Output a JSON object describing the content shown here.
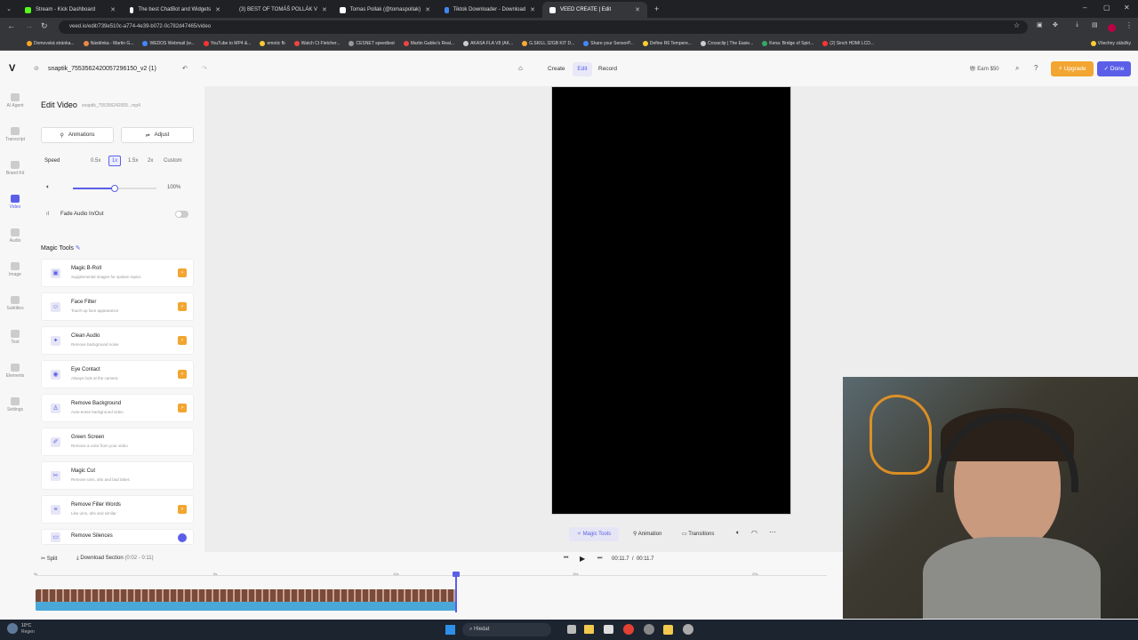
{
  "browser": {
    "tabs": [
      {
        "title": "Stream - Kick Dashboard",
        "color": "#53fc18"
      },
      {
        "title": "The best ChatBot and Widgets",
        "color": "#ffffff"
      },
      {
        "title": "(3) BEST OF TOMÁŠ POLLÁK V",
        "color": "#ff0000"
      },
      {
        "title": "Tomas Pollak (@tomaspollak)",
        "color": "#ffffff"
      },
      {
        "title": "Tiktok Downloader - Download",
        "color": "#4285f4"
      },
      {
        "title": "VEED CREATE | Edit",
        "color": "#ffffff"
      }
    ],
    "url": "veed.io/edit/739e510c-a774-4e39-b072-0c782d47465/video",
    "bookmarks": [
      "Domovská stránka...",
      "Nástěnka - Martin G...",
      "WEDOS Webmail (w...",
      "YouTube to MP4 &...",
      "emotic fb",
      "Watch Ct Fletcher...",
      "CESNET speedtest",
      "Martin Gabko's Real...",
      "AKASA FLA V8 (AK...",
      "G.SKILL 32GB KIT D...",
      "Share your SensorP...",
      "Define R6 Tempere...",
      "Crossclip | The Easie...",
      "Kena: Bridge of Spiri...",
      "(2) Sinch HDMI LCD...",
      "Všechny záložky"
    ]
  },
  "app": {
    "project_title": "snaptik_7553562420057296150_v2 (1)",
    "modes": [
      "Create",
      "Edit",
      "Record"
    ],
    "earn": "Earn $50",
    "upgrade": "Upgrade",
    "done": "Done"
  },
  "rail": [
    "AI Agent",
    "Transcript",
    "Brand Kit",
    "Video",
    "Audio",
    "Image",
    "Subtitles",
    "Text",
    "Elements",
    "Settings"
  ],
  "panel": {
    "title": "Edit Video",
    "file": "snaptik_755356242005...mp4",
    "animations": "Animations",
    "adjust": "Adjust",
    "speed_label": "Speed",
    "speeds": [
      "0.5x",
      "1x",
      "1.5x",
      "2x",
      "Custom"
    ],
    "volume": "100%",
    "volume_level": 0.5,
    "fade": "Fade Audio In/Out",
    "magic_title": "Magic Tools",
    "tools": [
      {
        "name": "Magic B-Roll",
        "desc": "Supplemental images for spoken topics",
        "badge": true
      },
      {
        "name": "Face Filter",
        "desc": "Touch-up face appearance",
        "badge": true
      },
      {
        "name": "Clean Audio",
        "desc": "Remove background noise",
        "badge": true
      },
      {
        "name": "Eye Contact",
        "desc": "Always look at the camera",
        "badge": true
      },
      {
        "name": "Remove Background",
        "desc": "Auto-erase background video",
        "badge": true
      },
      {
        "name": "Green Screen",
        "desc": "Remove a color from your video",
        "badge": false
      },
      {
        "name": "Magic Cut",
        "desc": "Remove ums, ahs and bad takes",
        "badge": false
      },
      {
        "name": "Remove Filler Words",
        "desc": "Like ums, ahs and similar",
        "badge": true
      },
      {
        "name": "Remove Silences",
        "desc": "",
        "badge": false
      }
    ]
  },
  "stage_toolbar": {
    "magic": "Magic Tools",
    "animation": "Animation",
    "transitions": "Transitions"
  },
  "timeline": {
    "split": "Split",
    "download": "Download Section",
    "range": "(0:02 - 0:11)",
    "current": "00:11.7",
    "sep": "/",
    "total": "00:11.7",
    "ticks": [
      "0s",
      "5s",
      "10s",
      "15s",
      "20s"
    ]
  },
  "taskbar": {
    "weather_temp": "10°C",
    "weather_desc": "Regen",
    "search": "Hledat"
  }
}
